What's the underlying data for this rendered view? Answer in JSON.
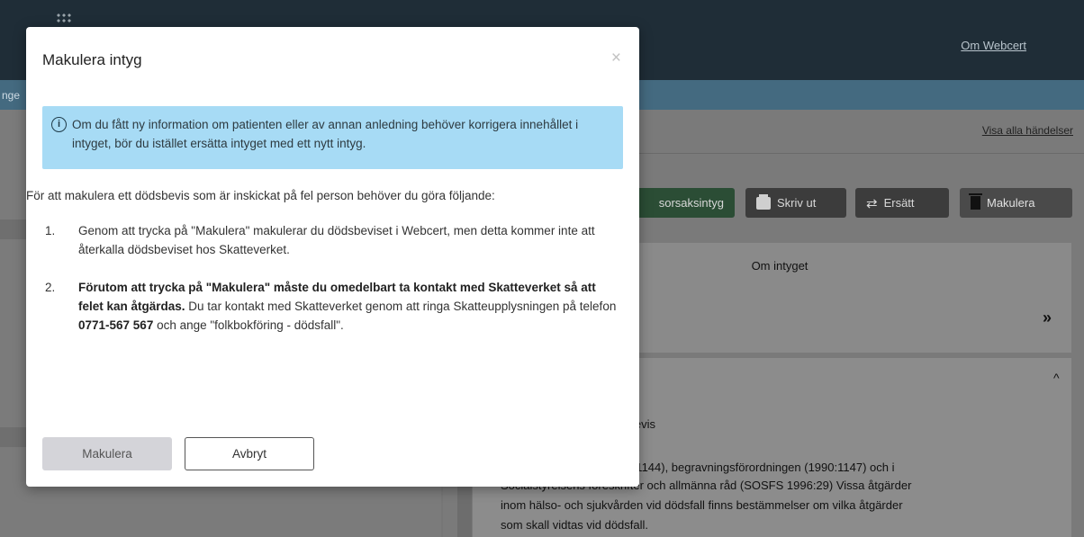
{
  "app": {
    "header_link": "Om Webcert",
    "infobar_fragment": "nge",
    "visa_alla": "Visa alla händelser",
    "actions": {
      "green_fragment": "sorsaksintyg",
      "print": "Skriv ut",
      "replace": "Ersätt",
      "cancel": "Makulera"
    },
    "about_title": "Om intyget",
    "doc_lines": [
      "idsbevis",
      "990:1144), begravningsförordningen (1990:1147) och i",
      "Socialstyrelsens föreskrifter och allmänna råd (SOSFS 1996:29) Vissa åtgärder",
      "inom hälso- och sjukvården vid dödsfall finns bestämmelser om vilka åtgärder",
      "som skall vidtas vid dödsfall."
    ]
  },
  "modal": {
    "title": "Makulera intyg",
    "close": "×",
    "info_text": "Om du fått ny information om patienten eller av annan anledning behöver korrigera innehållet i intyget, bör du istället ersätta intyget med ett nytt intyg.",
    "intro": "För att makulera ett dödsbevis som är inskickat på fel person behöver du göra följande:",
    "step1": {
      "num": "1.",
      "text": "Genom att trycka på \"Makulera\" makulerar du dödsbeviset i Webcert, men detta kommer inte att återkalla dödsbeviset hos Skatteverket."
    },
    "step2": {
      "num": "2.",
      "bold": "Förutom att trycka på \"Makulera\" måste du omedelbart ta kontakt med Skatteverket så att felet kan åtgärdas.",
      "text_a": " Du tar kontakt med Skatteverket genom att ringa Skatteupplysningen på telefon ",
      "phone": "0771-567 567",
      "text_b": " och ange \"folkbokföring - dödsfall\"."
    },
    "confirm_label": "Makulera",
    "cancel_label": "Avbryt"
  }
}
